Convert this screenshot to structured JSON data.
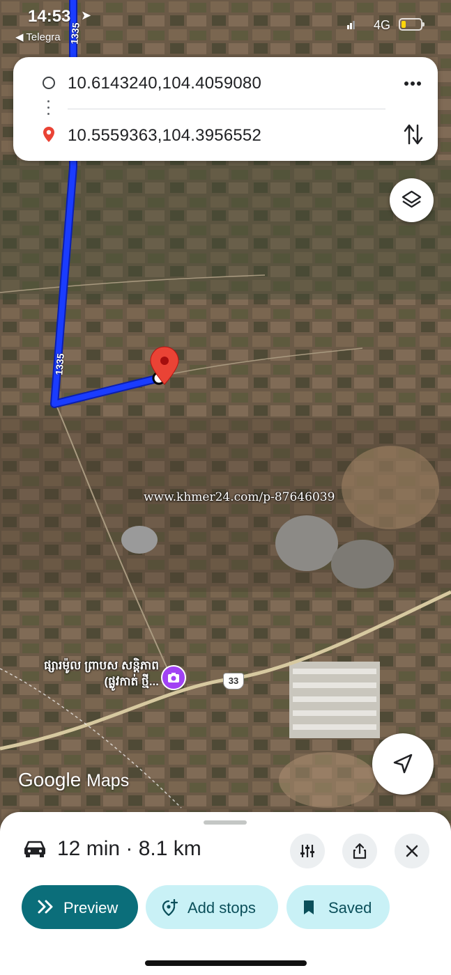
{
  "status_bar": {
    "time": "14:53",
    "back_app": "◀ Telegra",
    "network": "4G"
  },
  "route_card": {
    "origin": "10.6143240,104.4059080",
    "destination": "10.5559363,104.3956552"
  },
  "map": {
    "watermark": "www.khmer24.com/p-87646039",
    "place_label": "ផ្សារម៉ូល ព្រាបស សន្តិភាព (ផ្លូវកាត់ ថ្មី...",
    "road_1335_top": "1335",
    "road_1335_mid": "1335",
    "road_33": "33",
    "logo_google": "Google",
    "logo_maps": "Maps"
  },
  "sheet": {
    "summary": "12 min · 8.1 km",
    "preview_label": "Preview",
    "add_stops_label": "Add stops",
    "saved_label": "Saved"
  },
  "colors": {
    "route": "#1a3cff",
    "preview_bg": "#0b6e7a",
    "pill_bg": "#c9f1f6",
    "pin": "#ea4335",
    "place_pin": "#a142f4"
  }
}
